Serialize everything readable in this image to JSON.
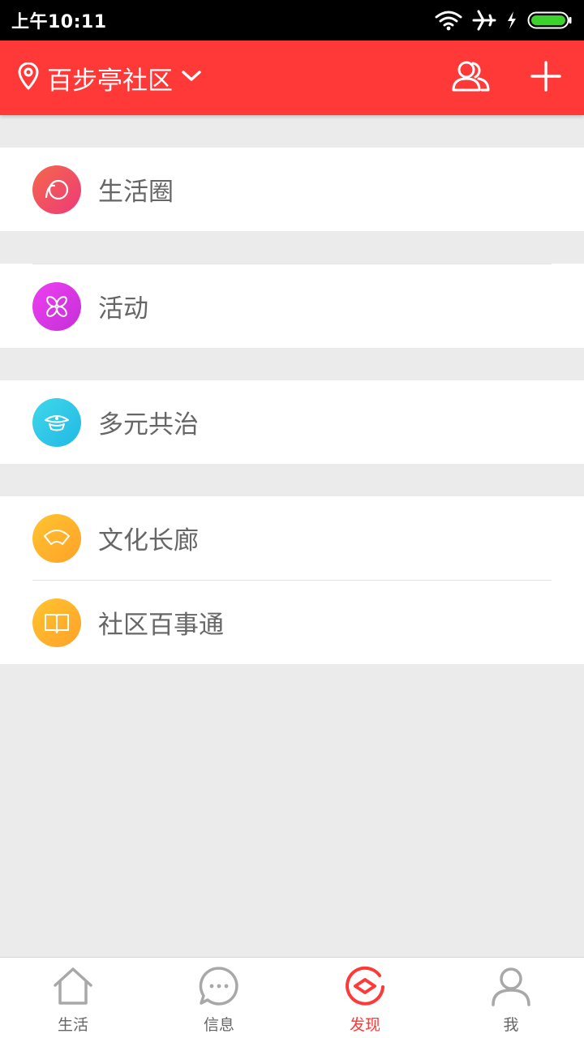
{
  "status_bar": {
    "time": "上午10:11"
  },
  "header": {
    "location": "百步亭社区"
  },
  "groups": [
    {
      "items": [
        {
          "label": "生活圈",
          "icon": "circle-icon"
        }
      ]
    },
    {
      "items": [
        {
          "label": "活动",
          "icon": "pinwheel-icon"
        }
      ]
    },
    {
      "items": [
        {
          "label": "多元共治",
          "icon": "cap-icon"
        }
      ]
    },
    {
      "items": [
        {
          "label": "文化长廊",
          "icon": "fan-icon"
        },
        {
          "label": "社区百事通",
          "icon": "book-icon"
        }
      ]
    }
  ],
  "bottom_nav": [
    {
      "label": "生活",
      "icon": "home-icon"
    },
    {
      "label": "信息",
      "icon": "chat-icon"
    },
    {
      "label": "发现",
      "icon": "discover-icon",
      "active": true
    },
    {
      "label": "我",
      "icon": "profile-icon"
    }
  ],
  "colors": {
    "brand": "#ff3838",
    "circle": "#f25260",
    "pinwheel": "#e13ee8",
    "cap": "#2cc8e8",
    "fan": "#ffb52a",
    "book": "#ffb52a"
  }
}
